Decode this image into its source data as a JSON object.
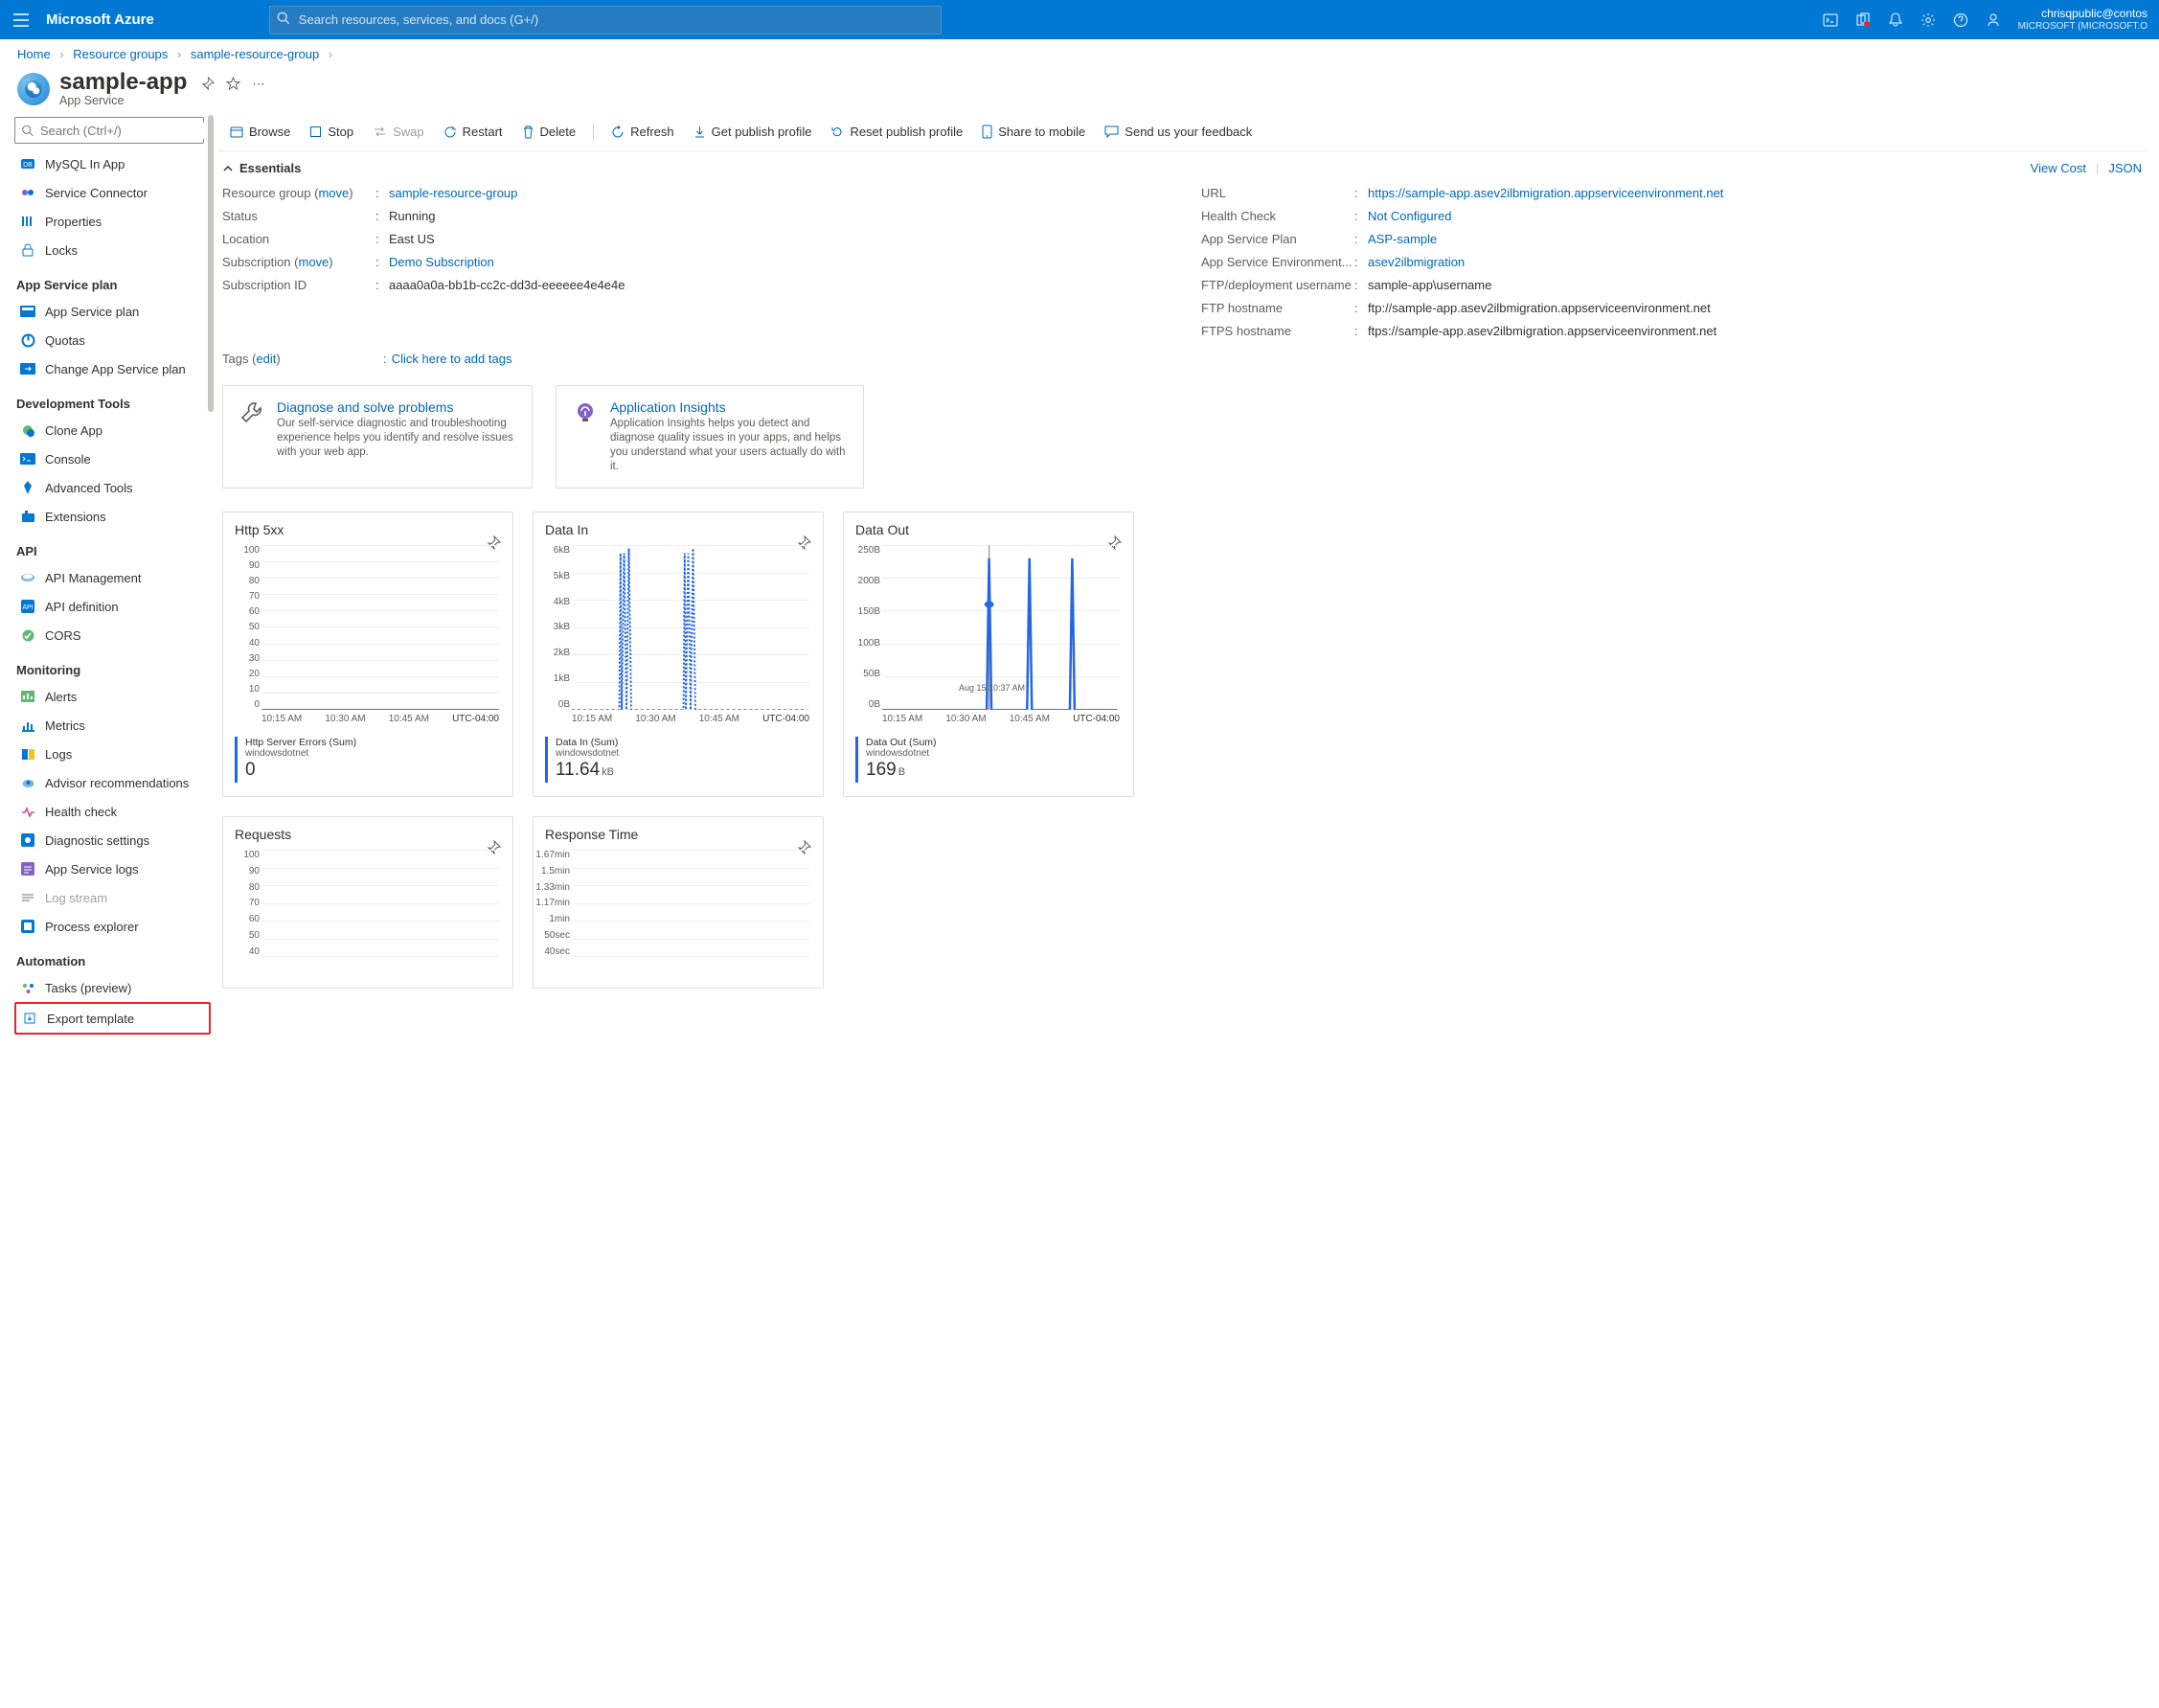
{
  "brand": "Microsoft Azure",
  "search_placeholder": "Search resources, services, and docs (G+/)",
  "user": {
    "email": "chrisqpublic@contos",
    "tenant": "MICROSOFT (MICROSOFT.O"
  },
  "breadcrumbs": [
    "Home",
    "Resource groups",
    "sample-resource-group"
  ],
  "page": {
    "title": "sample-app",
    "type": "App Service"
  },
  "menu_search_placeholder": "Search (Ctrl+/)",
  "nav_top": [
    {
      "icon": "mysql",
      "label": "MySQL In App"
    },
    {
      "icon": "connector",
      "label": "Service Connector"
    },
    {
      "icon": "props",
      "label": "Properties"
    },
    {
      "icon": "lock",
      "label": "Locks"
    }
  ],
  "nav_groups": [
    {
      "title": "App Service plan",
      "items": [
        {
          "icon": "plan",
          "label": "App Service plan"
        },
        {
          "icon": "quota",
          "label": "Quotas"
        },
        {
          "icon": "change",
          "label": "Change App Service plan"
        }
      ]
    },
    {
      "title": "Development Tools",
      "items": [
        {
          "icon": "clone",
          "label": "Clone App"
        },
        {
          "icon": "console",
          "label": "Console"
        },
        {
          "icon": "advtools",
          "label": "Advanced Tools"
        },
        {
          "icon": "ext",
          "label": "Extensions"
        }
      ]
    },
    {
      "title": "API",
      "items": [
        {
          "icon": "apimgmt",
          "label": "API Management"
        },
        {
          "icon": "apidef",
          "label": "API definition"
        },
        {
          "icon": "cors",
          "label": "CORS"
        }
      ]
    },
    {
      "title": "Monitoring",
      "items": [
        {
          "icon": "alerts",
          "label": "Alerts"
        },
        {
          "icon": "metrics",
          "label": "Metrics"
        },
        {
          "icon": "logs",
          "label": "Logs"
        },
        {
          "icon": "advisor",
          "label": "Advisor recommendations"
        },
        {
          "icon": "health",
          "label": "Health check"
        },
        {
          "icon": "diag",
          "label": "Diagnostic settings"
        },
        {
          "icon": "applogs",
          "label": "App Service logs"
        },
        {
          "icon": "logstream",
          "label": "Log stream",
          "dim": true
        },
        {
          "icon": "procexp",
          "label": "Process explorer"
        }
      ]
    },
    {
      "title": "Automation",
      "items": [
        {
          "icon": "tasks",
          "label": "Tasks (preview)"
        },
        {
          "icon": "export",
          "label": "Export template",
          "highlight": true
        }
      ]
    }
  ],
  "toolbar": [
    {
      "icon": "browse",
      "label": "Browse"
    },
    {
      "icon": "stop",
      "label": "Stop"
    },
    {
      "icon": "swap",
      "label": "Swap",
      "dim": true
    },
    {
      "icon": "restart",
      "label": "Restart"
    },
    {
      "icon": "delete",
      "label": "Delete"
    },
    {
      "sep": true
    },
    {
      "icon": "refresh",
      "label": "Refresh"
    },
    {
      "icon": "download",
      "label": "Get publish profile"
    },
    {
      "icon": "reset",
      "label": "Reset publish profile"
    },
    {
      "icon": "mobile",
      "label": "Share to mobile"
    },
    {
      "icon": "feedback",
      "label": "Send us your feedback"
    }
  ],
  "essentials_title": "Essentials",
  "view_cost": "View Cost",
  "json": "JSON",
  "essentials_left": [
    {
      "label": "Resource group (",
      "link_in_label": "move",
      "label2": ")",
      "colon": ")",
      "val_link": "sample-resource-group"
    },
    {
      "label": "Status",
      "val": "Running"
    },
    {
      "label": "Location",
      "val": "East US"
    },
    {
      "label": "Subscription (",
      "link_in_label": "move",
      "label2": ")",
      "val_link": "Demo Subscription"
    },
    {
      "label": "Subscription ID",
      "val": "aaaa0a0a-bb1b-cc2c-dd3d-eeeeee4e4e4e"
    }
  ],
  "essentials_right": [
    {
      "label": "URL",
      "val_link": "https://sample-app.asev2ilbmigration.appserviceenvironment.net"
    },
    {
      "label": "Health Check",
      "val_link": "Not Configured"
    },
    {
      "label": "App Service Plan",
      "val_link": "ASP-sample"
    },
    {
      "label": "App Service Environment...",
      "val_link": "asev2ilbmigration"
    },
    {
      "label": "FTP/deployment username",
      "val": "sample-app\\username"
    },
    {
      "label": "FTP hostname",
      "val": "ftp://sample-app.asev2ilbmigration.appserviceenvironment.net"
    },
    {
      "label": "FTPS hostname",
      "val": "ftps://sample-app.asev2ilbmigration.appserviceenvironment.net"
    }
  ],
  "tags_label": "Tags (",
  "tags_edit": "edit",
  "tags_label2": ")",
  "tags_link": "Click here to add tags",
  "info_cards": [
    {
      "icon": "wrench",
      "title": "Diagnose and solve problems",
      "desc": "Our self-service diagnostic and troubleshooting experience helps you identify and resolve issues with your web app."
    },
    {
      "icon": "bulb",
      "title": "Application Insights",
      "desc": "Application Insights helps you detect and diagnose quality issues in your apps, and helps you understand what your users actually do with it."
    }
  ],
  "tiles": [
    {
      "title": "Http 5xx",
      "metric_name": "Http Server Errors (Sum)",
      "metric_sub": "windowsdotnet",
      "metric_val": "0",
      "unit": "",
      "chart": "flat0",
      "y": [
        "100",
        "90",
        "80",
        "70",
        "60",
        "50",
        "40",
        "30",
        "20",
        "10",
        "0"
      ]
    },
    {
      "title": "Data In",
      "metric_name": "Data In (Sum)",
      "metric_sub": "windowsdotnet",
      "metric_val": "11.64",
      "unit": "kB",
      "chart": "datain",
      "y": [
        "6kB",
        "5kB",
        "4kB",
        "3kB",
        "2kB",
        "1kB",
        "0B"
      ]
    },
    {
      "title": "Data Out",
      "metric_name": "Data Out (Sum)",
      "metric_sub": "windowsdotnet",
      "metric_val": "169",
      "unit": "B",
      "chart": "dataout",
      "y": [
        "250B",
        "200B",
        "150B",
        "100B",
        "50B",
        "0B"
      ],
      "annot": "Aug 15 10:37 AM"
    }
  ],
  "tiles2": [
    {
      "title": "Requests",
      "y": [
        "100",
        "90",
        "80",
        "70",
        "60",
        "50",
        "40"
      ]
    },
    {
      "title": "Response Time",
      "y": [
        "1.67min",
        "1.5min",
        "1.33min",
        "1.17min",
        "1min",
        "50sec",
        "40sec"
      ]
    }
  ],
  "x_labels": [
    "10:15 AM",
    "10:30 AM",
    "10:45 AM",
    "UTC-04:00"
  ]
}
